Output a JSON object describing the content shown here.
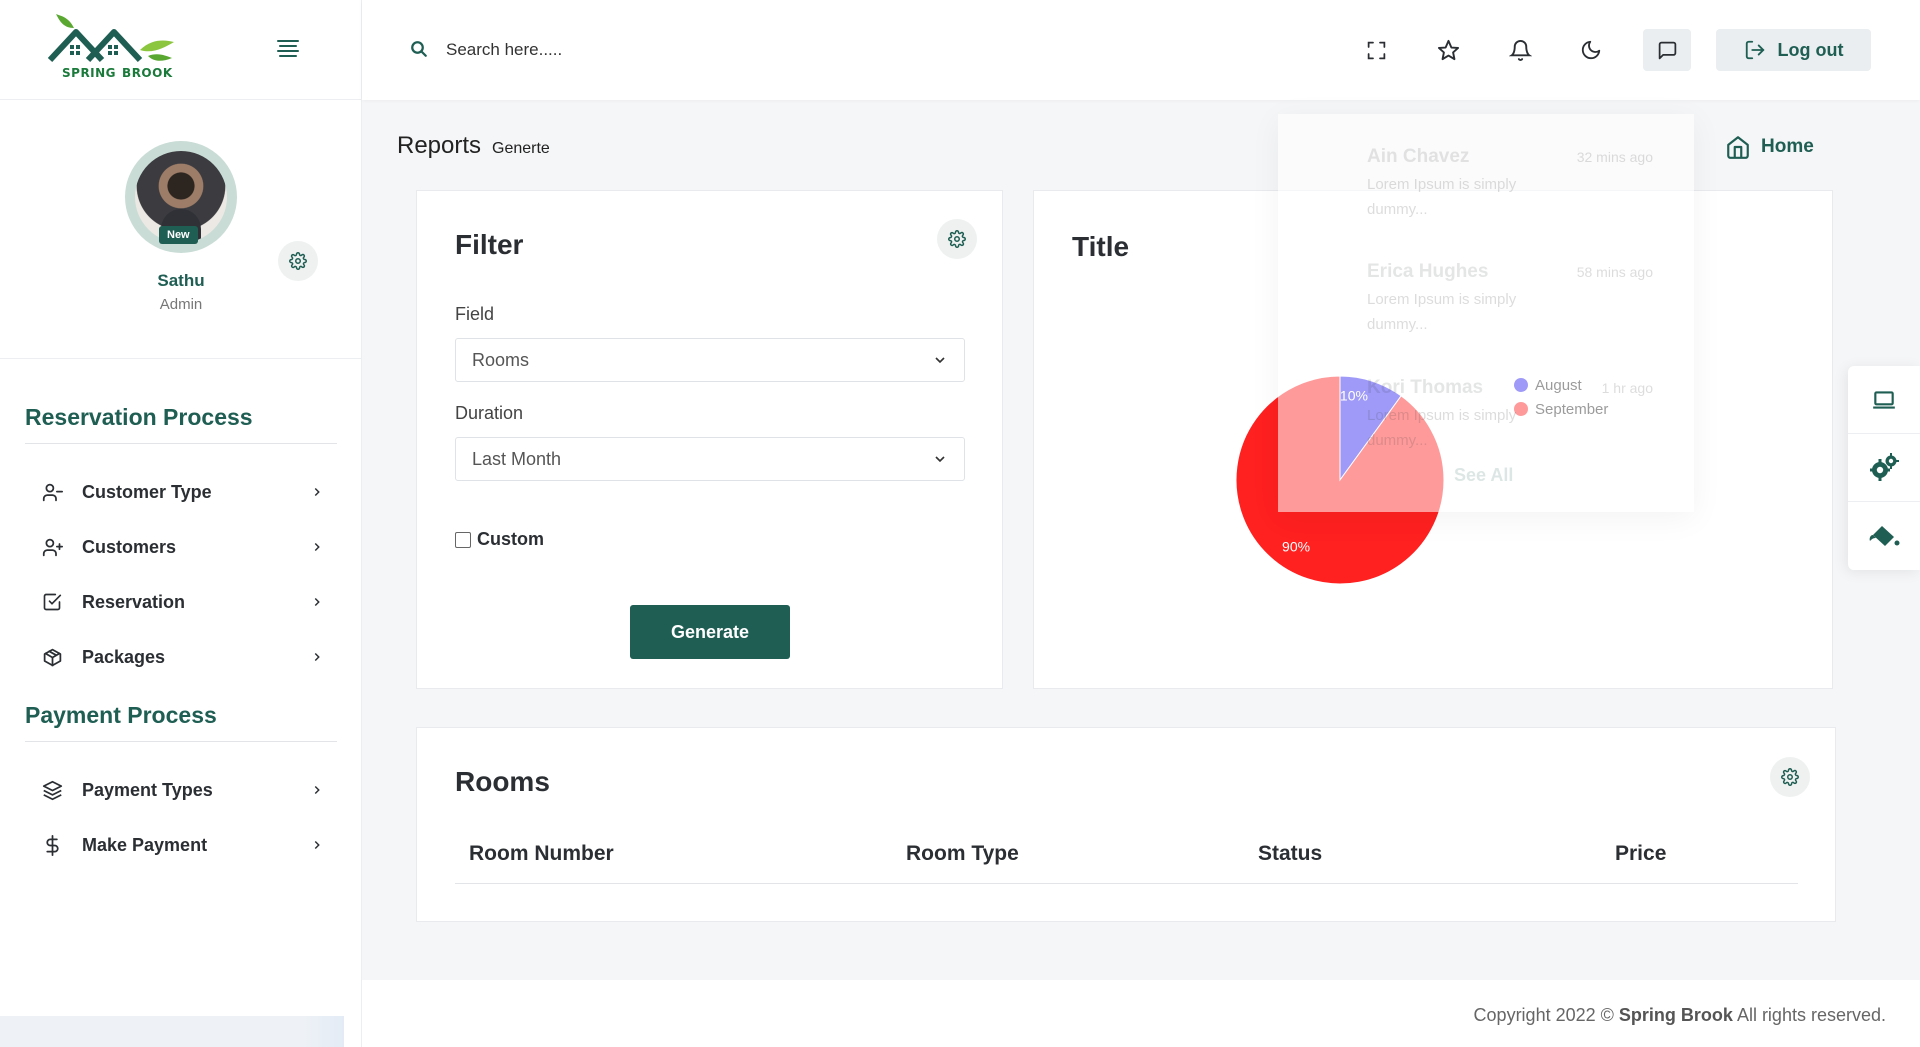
{
  "brand": {
    "name_line1": "SPRING",
    "name_line2": "BROOK"
  },
  "profile": {
    "name": "Sathu",
    "role": "Admin",
    "badge": "New"
  },
  "sidebar": {
    "sections": [
      {
        "title": "Reservation Process",
        "items": [
          {
            "label": "Customer Type",
            "icon": "user-minus-icon"
          },
          {
            "label": "Customers",
            "icon": "user-plus-icon"
          },
          {
            "label": "Reservation",
            "icon": "check-square-icon"
          },
          {
            "label": "Packages",
            "icon": "package-icon"
          }
        ]
      },
      {
        "title": "Payment Process",
        "items": [
          {
            "label": "Payment Types",
            "icon": "layers-icon"
          },
          {
            "label": "Make Payment",
            "icon": "dollar-icon"
          }
        ]
      }
    ]
  },
  "header": {
    "search_placeholder": "Search here.....",
    "logout_label": "Log out"
  },
  "breadcrumb": {
    "title": "Reports",
    "subtitle": "Generte",
    "home_label": "Home"
  },
  "filter": {
    "title": "Filter",
    "field_label": "Field",
    "field_value": "Rooms",
    "duration_label": "Duration",
    "duration_value": "Last Month",
    "custom_label": "Custom",
    "custom_checked": false,
    "generate_label": "Generate"
  },
  "chart_card": {
    "title": "Title"
  },
  "chart_data": {
    "type": "pie",
    "categories": [
      "August",
      "September"
    ],
    "values": [
      10,
      90
    ],
    "labels": [
      "10%",
      "90%"
    ],
    "colors": [
      "#2b1ff0",
      "#ff2020"
    ],
    "legend_position": "right"
  },
  "notifications": {
    "items": [
      {
        "name": "Ain Chavez",
        "time": "32 mins ago",
        "text": "Lorem Ipsum is simply dummy..."
      },
      {
        "name": "Erica Hughes",
        "time": "58 mins ago",
        "text": "Lorem Ipsum is simply dummy..."
      },
      {
        "name": "Kori Thomas",
        "time": "1 hr ago",
        "text": "Lorem Ipsum is simply dummy..."
      }
    ],
    "see_all": "See All"
  },
  "rooms_table": {
    "title": "Rooms",
    "columns": [
      "Room Number",
      "Room Type",
      "Status",
      "Price"
    ],
    "rows": []
  },
  "footer": {
    "prefix": "Copyright 2022 ©",
    "brand": "Spring Brook",
    "suffix": "All rights reserved."
  },
  "colors": {
    "primary": "#1f5e53",
    "august": "#2b1ff0",
    "september": "#ff2020"
  }
}
